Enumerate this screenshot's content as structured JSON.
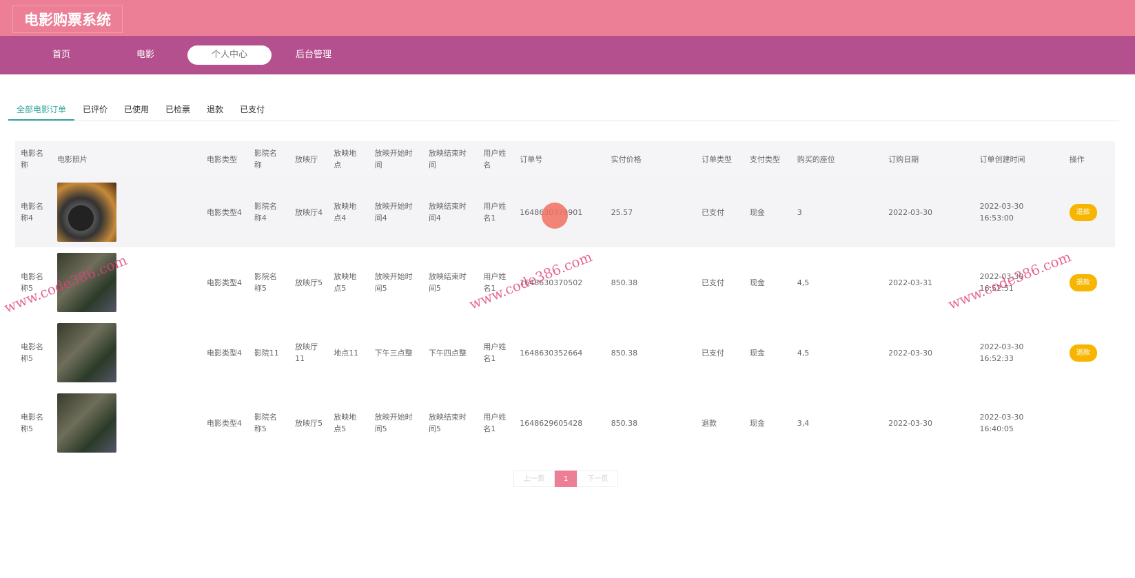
{
  "header": {
    "title": "电影购票系统"
  },
  "nav": [
    "首页",
    "电影",
    "个人中心",
    "后台管理"
  ],
  "tabs": [
    "全部电影订单",
    "已评价",
    "已使用",
    "已检票",
    "退款",
    "已支付"
  ],
  "table": {
    "headers": [
      "电影名称",
      "电影照片",
      "电影类型",
      "影院名称",
      "放映厅",
      "放映地点",
      "放映开始时间",
      "放映结束时间",
      "用户姓名",
      "订单号",
      "实付价格",
      "订单类型",
      "支付类型",
      "购买的座位",
      "订购日期",
      "订单创建时间",
      "操作"
    ],
    "rows": [
      [
        "电影名称4",
        "",
        "电影类型4",
        "影院名称4",
        "放映厅4",
        "放映地点4",
        "放映开始时间4",
        "放映结束时间4",
        "用户姓名1",
        "1648630379901",
        "25.57",
        "已支付",
        "现金",
        "3",
        "2022-03-30",
        "2022-03-30 16:53:00",
        "退款"
      ],
      [
        "电影名称5",
        "",
        "电影类型4",
        "影院名称5",
        "放映厅5",
        "放映地点5",
        "放映开始时间5",
        "放映结束时间5",
        "用户姓名1",
        "1648630370502",
        "850.38",
        "已支付",
        "现金",
        "4,5",
        "2022-03-31",
        "2022-03-30 16:52:51",
        "退款"
      ],
      [
        "电影名称5",
        "",
        "电影类型4",
        "影院11",
        "放映厅11",
        "地点11",
        "下午三点整",
        "下午四点整",
        "用户姓名1",
        "1648630352664",
        "850.38",
        "已支付",
        "现金",
        "4,5",
        "2022-03-30",
        "2022-03-30 16:52:33",
        "退款"
      ],
      [
        "电影名称5",
        "",
        "电影类型4",
        "影院名称5",
        "放映厅5",
        "放映地点5",
        "放映开始时间5",
        "放映结束时间5",
        "用户姓名1",
        "1648629605428",
        "850.38",
        "退款",
        "现金",
        "3,4",
        "2022-03-30",
        "2022-03-30 16:40:05",
        ""
      ]
    ]
  },
  "pager": {
    "prev": "上一页",
    "page": "1",
    "next": "下一页"
  },
  "watermark": "www.code386.com"
}
